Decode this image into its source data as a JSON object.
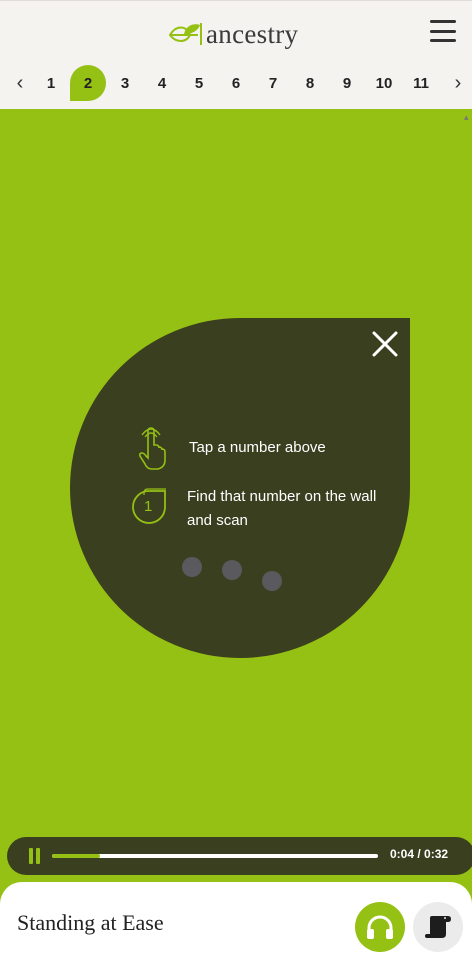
{
  "header": {
    "logo_text": "ancestry",
    "numbers": [
      "1",
      "2",
      "3",
      "4",
      "5",
      "6",
      "7",
      "8",
      "9",
      "10",
      "11"
    ],
    "active_number": "2"
  },
  "popup": {
    "instruction_1": "Tap a number above",
    "instruction_2": "Find that number on the wall and scan",
    "step_icon_number": "1"
  },
  "player": {
    "time": "0:04 / 0:32",
    "progress_fraction": 0.146
  },
  "footer": {
    "title": "Standing at Ease"
  },
  "colors": {
    "accent": "#95c014",
    "dark": "#3a3f1f"
  }
}
